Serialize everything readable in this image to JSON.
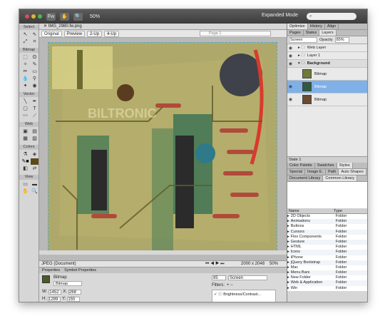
{
  "topbar": {
    "zoom": "50%",
    "mode": "Expanded Mode",
    "search_placeholder": "",
    "tab_title": "IMG_2980.fw.png"
  },
  "tools": {
    "sections": [
      "Select",
      "Bitmap",
      "Vector",
      "Web",
      "Colors",
      "View"
    ]
  },
  "view_modes": {
    "original": "Original",
    "preview": "Preview",
    "two_up": "2-Up",
    "four_up": "4-Up",
    "page": "Page 1"
  },
  "status": {
    "format": "JPEG (Document)",
    "dimensions": "2000 x 2048",
    "zoom": "50%"
  },
  "properties": {
    "tabs": [
      "Properties",
      "Symbol Properties"
    ],
    "object_type": "Bitmap",
    "object_name": "Bitmap",
    "w_label": "W:",
    "w_value": "1452",
    "h_label": "H:",
    "h_value": "1289",
    "x_label": "X:",
    "x_value": "268",
    "y_label": "Y:",
    "y_value": "155",
    "opacity": "85",
    "blend": "Screen",
    "filters_label": "Filters:",
    "filter_item": "Brightness/Contrast..."
  },
  "right_panel": {
    "top_tabs": [
      "Optimize",
      "History",
      "Align"
    ],
    "layer_tabs": [
      "Pages",
      "States",
      "Layers"
    ],
    "blend_mode": "Screen",
    "opacity_label": "Opacity",
    "opacity_value": "85%",
    "layers": [
      {
        "name": "Web Layer"
      },
      {
        "name": "Layer 1"
      },
      {
        "name": "Background"
      },
      {
        "name": "Bitmap"
      },
      {
        "name": "Bitmap"
      },
      {
        "name": "Bitmap"
      }
    ],
    "state_label": "State 1",
    "mid_tabs": [
      "Color Palette",
      "Swatches",
      "Styles"
    ],
    "mid_tabs2": [
      "Special",
      "Image E.",
      "Path",
      "Auto Shapes"
    ],
    "lib_tabs": [
      "Document Library",
      "Common Library"
    ],
    "lib_columns": [
      "Name",
      "Type"
    ],
    "lib_items": [
      {
        "name": "2D Objects",
        "type": "Folder"
      },
      {
        "name": "Animations",
        "type": "Folder"
      },
      {
        "name": "Buttons",
        "type": "Folder"
      },
      {
        "name": "Cursors",
        "type": "Folder"
      },
      {
        "name": "Flex Components",
        "type": "Folder"
      },
      {
        "name": "Gesture",
        "type": "Folder"
      },
      {
        "name": "HTML",
        "type": "Folder"
      },
      {
        "name": "Icons",
        "type": "Folder"
      },
      {
        "name": "iPhone",
        "type": "Folder"
      },
      {
        "name": "jQuery Bootstrap",
        "type": "Folder"
      },
      {
        "name": "Mac",
        "type": "Folder"
      },
      {
        "name": "Menu Bars",
        "type": "Folder"
      },
      {
        "name": "New Folder",
        "type": "Folder"
      },
      {
        "name": "Web & Application",
        "type": "Folder"
      },
      {
        "name": "Win",
        "type": "Folder"
      }
    ]
  },
  "colors": {
    "selection": "#7fb0e8",
    "canvas_border": "#4aa8d8"
  }
}
